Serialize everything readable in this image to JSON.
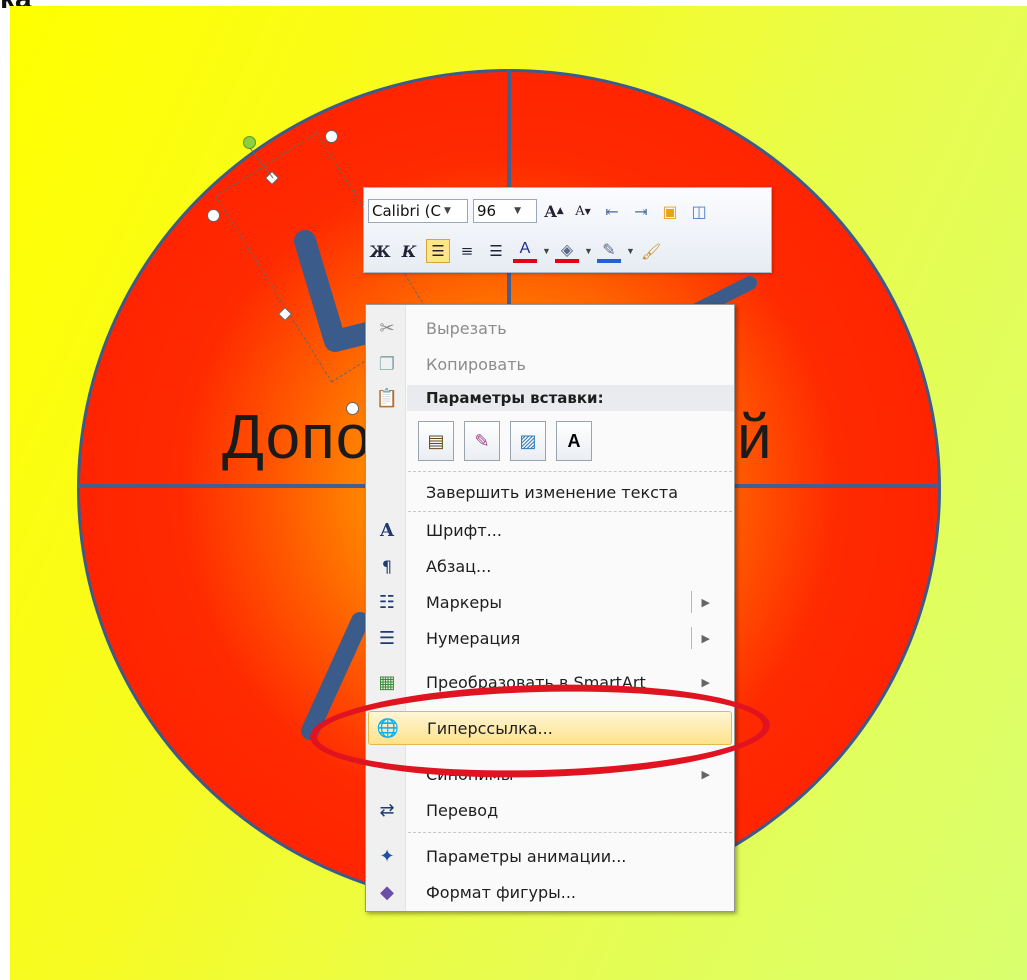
{
  "slide": {
    "title_fragment": "ка",
    "word_left": "Допо",
    "word_right": "й"
  },
  "mini_toolbar": {
    "font_name": "Calibri (С",
    "font_size": "96",
    "row1_buttons": [
      "grow-font",
      "shrink-font",
      "decrease-indent",
      "increase-indent",
      "bring-forward",
      "send-backward"
    ],
    "bold_label": "Ж",
    "italic_label": "К",
    "font_color_label": "A"
  },
  "context_menu": {
    "cut": "Вырезать",
    "copy": "Копировать",
    "paste_header": "Параметры вставки:",
    "paste_option_text_label": "A",
    "finish_edit": "Завершить изменение текста",
    "font": "Шрифт...",
    "paragraph": "Абзац...",
    "bullets": "Маркеры",
    "numbering": "Нумерация",
    "convert_smartart": "Преобразовать в SmartArt",
    "hyperlink": "Гиперссылка...",
    "synonyms": "Синонимы",
    "translate": "Перевод",
    "animation": "Параметры анимации...",
    "format_shape": "Формат фигуры..."
  },
  "colors": {
    "highlight_ellipse": "#e01320",
    "menu_highlight": "#fde28b",
    "slide_bg": "#ffff00",
    "circle_fill": "#ff2a00"
  }
}
